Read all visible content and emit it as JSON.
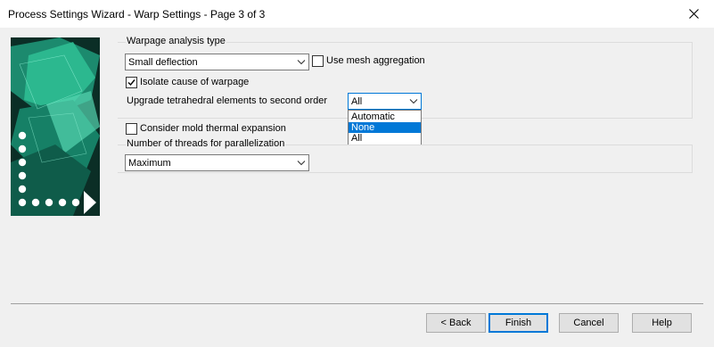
{
  "window": {
    "title": "Process Settings Wizard - Warp Settings - Page 3 of 3",
    "close_icon": "close-icon"
  },
  "warpage_group": {
    "label": "Warpage analysis type",
    "analysis_type_value": "Small deflection",
    "use_mesh_aggregation_label": "Use mesh aggregation",
    "use_mesh_aggregation_checked": false,
    "isolate_cause_label": "Isolate cause of warpage",
    "isolate_cause_checked": true,
    "upgrade_tetra_label": "Upgrade tetrahedral elements to second order",
    "upgrade_tetra_value": "All",
    "upgrade_tetra_options": [
      "Automatic",
      "None",
      "All"
    ],
    "upgrade_tetra_highlighted": "None"
  },
  "mold_thermal": {
    "label": "Consider mold thermal expansion",
    "checked": false
  },
  "threads_group": {
    "label": "Number of threads for parallelization",
    "value": "Maximum"
  },
  "buttons": {
    "back": "< Back",
    "finish": "Finish",
    "cancel": "Cancel",
    "help": "Help"
  },
  "colors": {
    "accent": "#0078d7",
    "dialog_bg": "#f0f0f0",
    "wizard_image_bg": "#0b2e26"
  }
}
